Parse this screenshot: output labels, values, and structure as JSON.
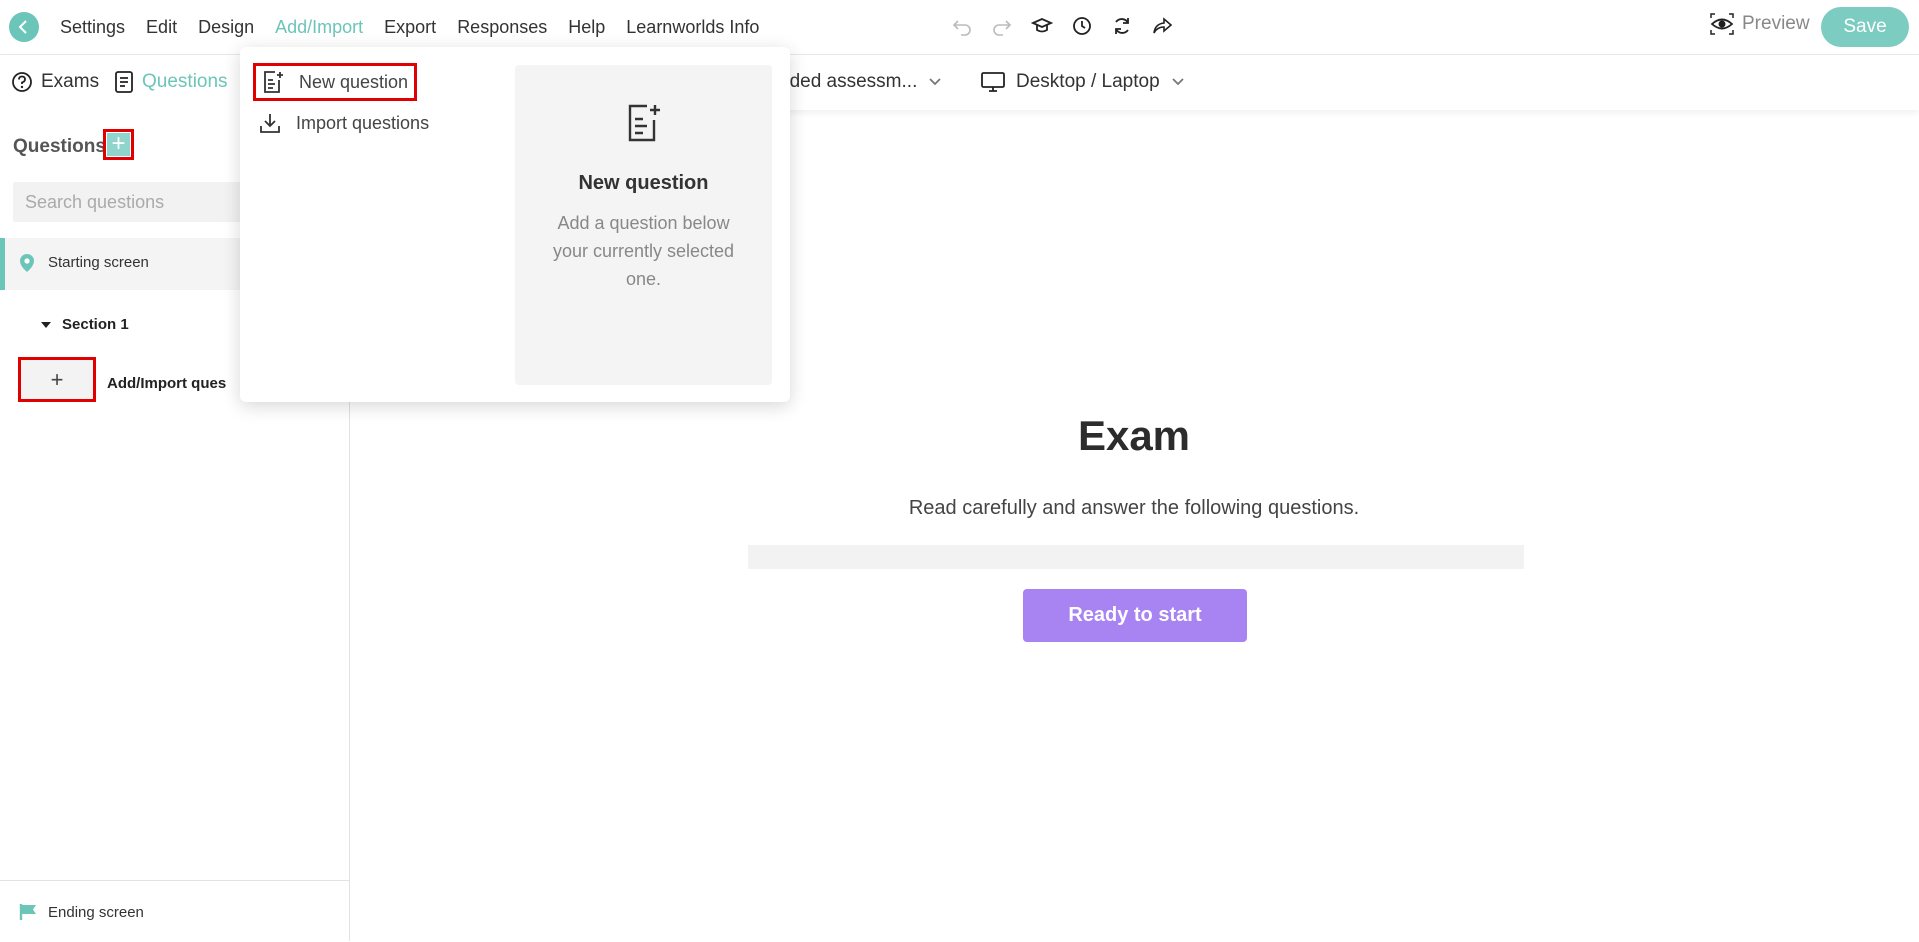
{
  "menu": {
    "items": [
      "Settings",
      "Edit",
      "Design",
      "Add/Import",
      "Export",
      "Responses",
      "Help",
      "Learnworlds Info"
    ],
    "active": "Add/Import"
  },
  "toolbar": {
    "icons": [
      "undo-icon",
      "redo-icon",
      "graduation-cap-icon",
      "clock-icon",
      "refresh-icon",
      "share-icon"
    ],
    "preview_label": "Preview",
    "save_label": "Save"
  },
  "subbar": {
    "tabs": [
      {
        "label": "Exams",
        "icon": "help-circle-icon"
      },
      {
        "label": "Questions",
        "icon": "document-icon",
        "active": true
      }
    ],
    "assessment_select": "aded assessm...",
    "device_select": "Desktop / Laptop"
  },
  "sidebar": {
    "title": "Questions",
    "search_placeholder": "Search questions",
    "starting_screen": "Starting screen",
    "section_label": "Section 1",
    "add_import_symbol": "+",
    "add_import_label": "Add/Import ques",
    "ending_screen": "Ending screen"
  },
  "dropdown": {
    "items": [
      "New question",
      "Import questions"
    ],
    "info_title": "New question",
    "info_desc": "Add a question below your currently selected one."
  },
  "main": {
    "title": "Exam",
    "subtitle": "Read carefully and answer the following questions.",
    "start_button": "Ready to start"
  },
  "colors": {
    "accent": "#6cc5b9",
    "start_button": "#a883f2",
    "highlight": "#e00000"
  }
}
